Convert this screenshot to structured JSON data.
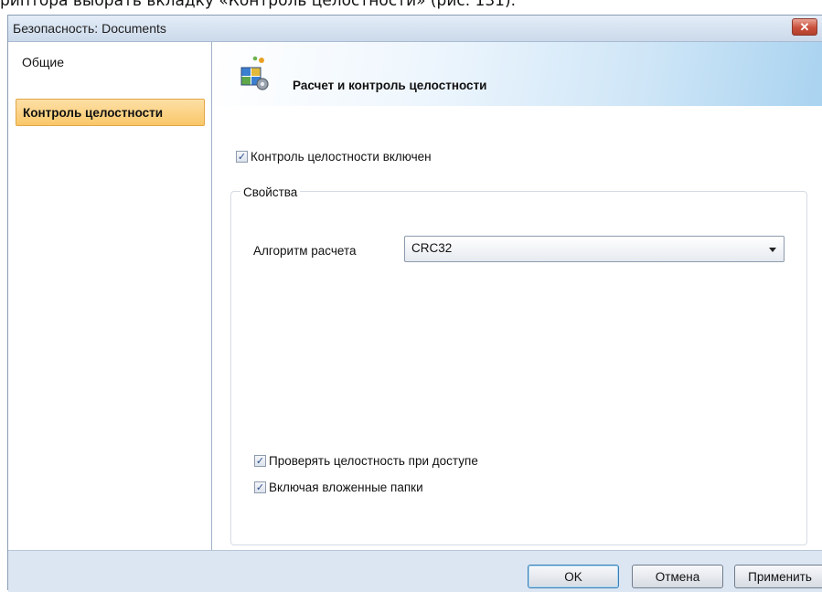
{
  "document": {
    "caption_fragment": "рипторa выбрать вкладку «Контроль целостности» (рис. 131)."
  },
  "window": {
    "title": "Безопасность: Documents",
    "close_glyph": "✕"
  },
  "nav": {
    "items": [
      {
        "label": "Общие",
        "selected": false
      },
      {
        "label": "Контроль целостности",
        "selected": true
      }
    ]
  },
  "header": {
    "title": "Расчет и контроль целостности",
    "icon": "integrity-check-icon"
  },
  "integrity": {
    "enabled_label": "Контроль целостности включен",
    "enabled_checked": true
  },
  "properties": {
    "legend": "Свойства",
    "algorithm_label": "Алгоритм расчета",
    "algorithm_value": "CRC32",
    "check_on_access_label": "Проверять целостность при доступе",
    "check_on_access_checked": true,
    "include_subfolders_label": "Включая вложенные папки",
    "include_subfolders_checked": true
  },
  "buttons": {
    "ok": "OK",
    "cancel": "Отмена",
    "apply": "Применить"
  },
  "colors": {
    "accent_selection": "#f9c769",
    "dialog_background": "#dce6f2",
    "close_button": "#c9503b"
  }
}
